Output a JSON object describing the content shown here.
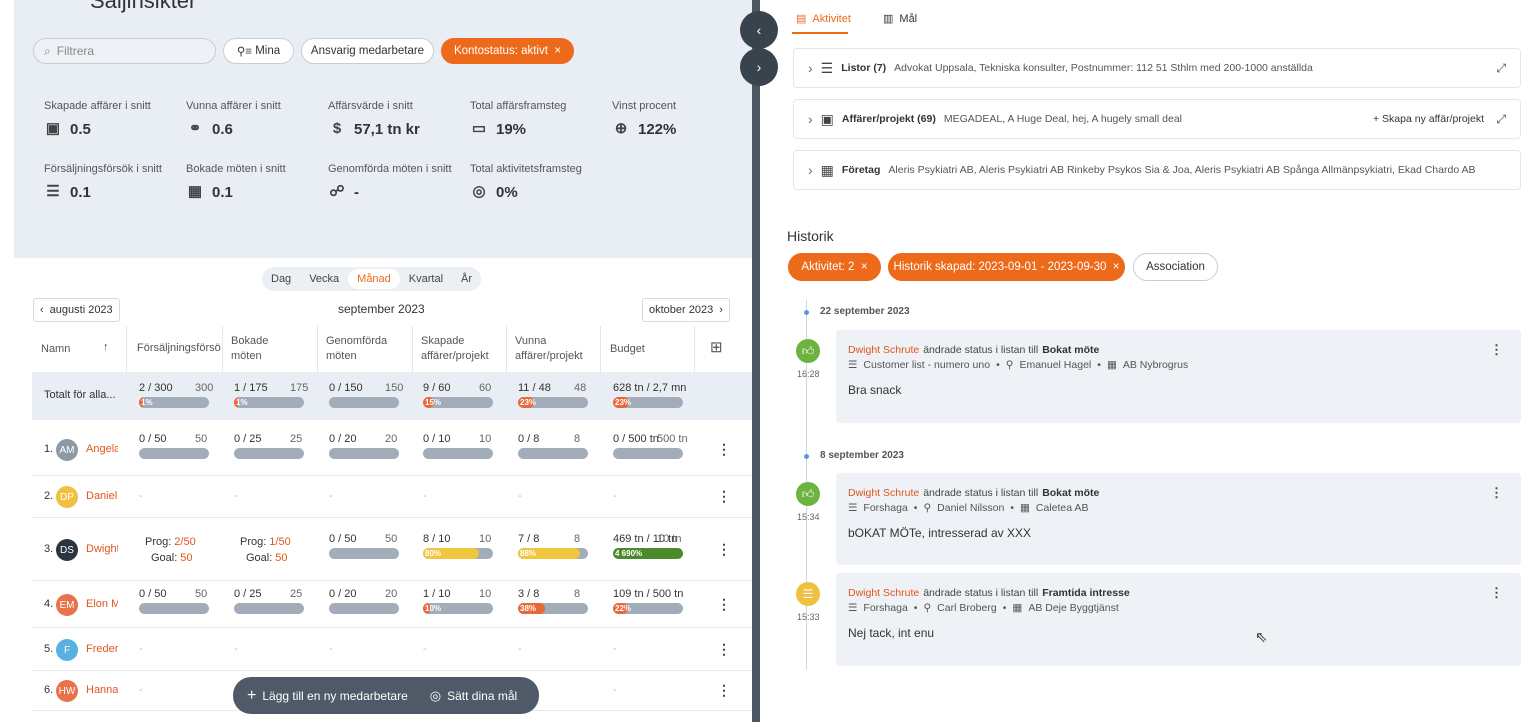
{
  "left": {
    "title": "Säljinsikter",
    "search_placeholder": "Filtrera",
    "filters": {
      "mina": "Mina",
      "ansvarig": "Ansvarig medarbetare",
      "kontostatus": "Kontostatus: aktivt"
    },
    "stats": [
      {
        "label": "Skapade affärer i snitt",
        "value": "0.5",
        "icon": "briefcase-icon"
      },
      {
        "label": "Vunna affärer i snitt",
        "value": "0.6",
        "icon": "handshake-icon"
      },
      {
        "label": "Affärsvärde i snitt",
        "value": "57,1 tn kr",
        "icon": "money-icon"
      },
      {
        "label": "Total affärsframsteg",
        "value": "19%",
        "icon": "progress-icon"
      },
      {
        "label": "Vinst procent",
        "value": "122%",
        "icon": "target-icon"
      },
      {
        "label": "Försäljningsförsök i snitt",
        "value": "0.1",
        "icon": "stack-icon"
      },
      {
        "label": "Bokade möten i snitt",
        "value": "0.1",
        "icon": "calendar-icon"
      },
      {
        "label": "Genomförda möten i snitt",
        "value": "-",
        "icon": "people-icon"
      },
      {
        "label": "Total aktivitetsframsteg",
        "value": "0%",
        "icon": "goal-icon"
      }
    ],
    "periods": [
      "Dag",
      "Vecka",
      "Månad",
      "Kvartal",
      "År"
    ],
    "active_period": "Månad",
    "prev_month": "augusti 2023",
    "current_month": "september 2023",
    "next_month": "oktober 2023",
    "columns": [
      "Namn",
      "Försäljningsförsök",
      "Bokade möten",
      "Genomförda möten",
      "Skapade affärer/projekt",
      "Vunna affärer/projekt",
      "Budget"
    ],
    "total": {
      "label": "Totalt för alla...",
      "cells": [
        {
          "a": "2 / 300",
          "b": "300",
          "pct": 1,
          "pl": "1%"
        },
        {
          "a": "1 / 175",
          "b": "175",
          "pct": 1,
          "pl": "1%"
        },
        {
          "a": "0 / 150",
          "b": "150",
          "pct": 0,
          "pl": ""
        },
        {
          "a": "9 / 60",
          "b": "60",
          "pct": 15,
          "pl": "15%"
        },
        {
          "a": "11 / 48",
          "b": "48",
          "pct": 23,
          "pl": "23%"
        },
        {
          "a": "628 tn / 2,7 mn",
          "b": "",
          "pct": 23,
          "pl": "23%"
        }
      ]
    },
    "people": [
      {
        "rank": "1.",
        "initials": "AM",
        "name": "Angela",
        "color": "#8e99a6",
        "cells": [
          {
            "a": "0 / 50",
            "b": "50",
            "pct": 0
          },
          {
            "a": "0 / 25",
            "b": "25",
            "pct": 0
          },
          {
            "a": "0 / 20",
            "b": "20",
            "pct": 0
          },
          {
            "a": "0 / 10",
            "b": "10",
            "pct": 0
          },
          {
            "a": "0 / 8",
            "b": "8",
            "pct": 0
          },
          {
            "a": "0 / 500 tn",
            "b": "500 tn",
            "pct": 0
          }
        ]
      },
      {
        "rank": "2.",
        "initials": "DP",
        "name": "Daniel",
        "color": "#f0c040"
      },
      {
        "rank": "3.",
        "initials": "DS",
        "name": "Dwight",
        "color": "#2b3440",
        "prog": [
          {
            "p": "2/50",
            "g": "50"
          },
          {
            "p": "1/50",
            "g": "50"
          }
        ],
        "cells": [
          {
            "a": "0 / 50",
            "b": "50",
            "pct": 0
          },
          {
            "a": "8 / 10",
            "b": "10",
            "pct": 80,
            "pl": "80%",
            "c": "#f0c63f"
          },
          {
            "a": "7 / 8",
            "b": "8",
            "pct": 88,
            "pl": "88%",
            "c": "#f0c63f"
          },
          {
            "a": "469 tn / 10 tn",
            "b": "10 tn",
            "pct": 100,
            "pl": "4 690%",
            "c": "#4a8a2a"
          }
        ]
      },
      {
        "rank": "4.",
        "initials": "EM",
        "name": "Elon M",
        "color": "#e8734a",
        "cells": [
          {
            "a": "0 / 50",
            "b": "50",
            "pct": 0
          },
          {
            "a": "0 / 25",
            "b": "25",
            "pct": 0
          },
          {
            "a": "0 / 20",
            "b": "20",
            "pct": 0
          },
          {
            "a": "1 / 10",
            "b": "10",
            "pct": 10,
            "pl": "10%"
          },
          {
            "a": "3 / 8",
            "b": "8",
            "pct": 38,
            "pl": "38%"
          },
          {
            "a": "109 tn / 500 tn",
            "b": "",
            "pct": 22,
            "pl": "22%"
          }
        ]
      },
      {
        "rank": "5.",
        "initials": "F",
        "name": "Frederik",
        "color": "#58b0e0"
      },
      {
        "rank": "6.",
        "initials": "HW",
        "name": "Hanna",
        "color": "#e8734a"
      }
    ],
    "prog_label": "Prog:",
    "goal_label": "Goal:",
    "fab_add": "Lägg till en ny medarbetare",
    "fab_goals": "Sätt dina mål"
  },
  "right": {
    "tabs": [
      "Aktivitet",
      "Mål"
    ],
    "boxes": [
      {
        "title": "Listor (7)",
        "text": "Advokat Uppsala, Tekniska konsulter, Postnummer: 112 51 Sthlm med 200-1000 anställda"
      },
      {
        "title": "Affärer/projekt (69)",
        "text": "MEGADEAL, A Huge Deal, hej, A hugely small deal",
        "action": "Skapa ny affär/projekt"
      },
      {
        "title": "Företag",
        "text": "Aleris Psykiatri AB, Aleris Psykiatri AB Rinkeby Psykos Sia & Joa, Aleris Psykiatri AB Spånga Allmänpsykiatri, Ekad Chardo AB"
      }
    ],
    "historik": "Historik",
    "hfilters": [
      "Aktivitet: 2",
      "Historik skapad: 2023-09-01 - 2023-09-30",
      "Association"
    ],
    "groups": [
      {
        "date": "22 september 2023",
        "entries": [
          {
            "time": "16:28",
            "who": "Dwight Schrute",
            "mid": "ändrade status i listan till",
            "status": "Bokat möte",
            "list": "Customer list - numero uno",
            "person": "Emanuel Hagel",
            "company": "AB Nybrogrus",
            "note": "Bra snack",
            "kind": "thumb"
          }
        ]
      },
      {
        "date": "8 september 2023",
        "entries": [
          {
            "time": "15:34",
            "who": "Dwight Schrute",
            "mid": "ändrade status i listan till",
            "status": "Bokat möte",
            "list": "Forshaga",
            "person": "Daniel Nilsson",
            "company": "Caletea AB",
            "note": "bOKAT MÖTe, intresserad av XXX",
            "kind": "thumb"
          },
          {
            "time": "15:33",
            "who": "Dwight Schrute",
            "mid": "ändrade status i listan till",
            "status": "Framtida intresse",
            "list": "Forshaga",
            "person": "Carl Broberg",
            "company": "AB Deje Byggtjänst",
            "note": "Nej tack, int enu",
            "kind": "list"
          }
        ]
      }
    ]
  }
}
